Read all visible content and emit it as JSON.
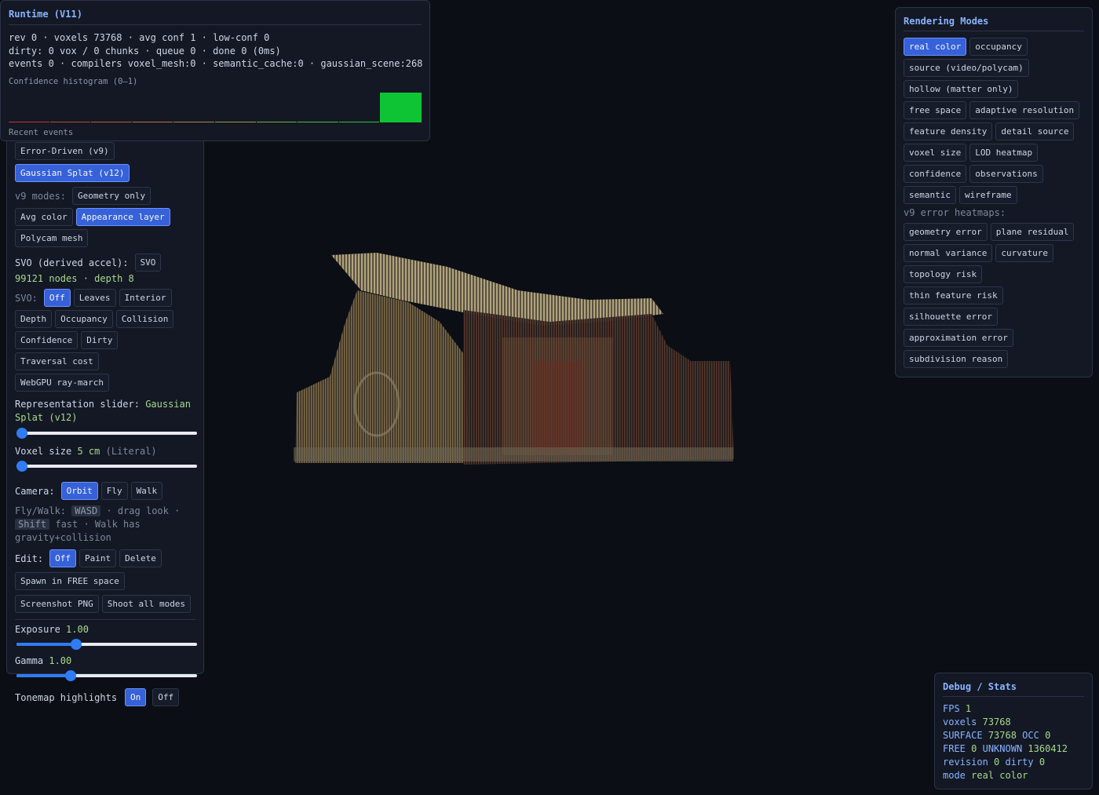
{
  "runtime": {
    "title": "Runtime (V11)",
    "line1": "rev 0 · voxels 73768 · avg conf 1 · low-conf 0",
    "line2": "dirty: 0 vox / 0 chunks · queue 0 · done 0 (0ms)",
    "line3": "events 0 · compilers voxel_mesh:0 · semantic_cache:0 · gaussian_scene:268",
    "histogram_label": "Confidence histogram (0–1)",
    "histogram_bins": [
      0,
      0,
      0,
      0,
      0,
      0,
      0,
      0,
      0,
      1
    ],
    "histogram_colors": [
      "#c4343c",
      "#c44634",
      "#c45a34",
      "#c47034",
      "#b48434",
      "#94a034",
      "#74b034",
      "#54b834",
      "#34c034",
      "#14c83a"
    ],
    "recent_events_label": "Recent events"
  },
  "left": {
    "mode_buttons": [
      {
        "label": "Error-Driven (v9)",
        "active": false
      },
      {
        "label": "Gaussian Splat (v12)",
        "active": true
      }
    ],
    "v9_modes_label": "v9 modes:",
    "v9_modes": [
      {
        "label": "Geometry only",
        "active": false
      },
      {
        "label": "Avg color",
        "active": false
      },
      {
        "label": "Appearance layer",
        "active": true
      },
      {
        "label": "Polycam mesh",
        "active": false
      }
    ],
    "svo_label": "SVO (derived accel):",
    "svo_button": "SVO",
    "svo_nodes": "99121 nodes",
    "svo_depth": "depth 8",
    "svo_modes_label": "SVO:",
    "svo_modes": [
      {
        "label": "Off",
        "active": true
      },
      {
        "label": "Leaves",
        "active": false
      },
      {
        "label": "Interior",
        "active": false
      },
      {
        "label": "Depth",
        "active": false
      },
      {
        "label": "Occupancy",
        "active": false
      },
      {
        "label": "Collision",
        "active": false
      },
      {
        "label": "Confidence",
        "active": false
      },
      {
        "label": "Dirty",
        "active": false
      },
      {
        "label": "Traversal cost",
        "active": false
      },
      {
        "label": "WebGPU ray-march",
        "active": false
      }
    ],
    "rep_slider_label": "Representation slider:",
    "rep_slider_value": "Gaussian Splat (v12)",
    "rep_slider_level": 0,
    "voxel_size_label": "Voxel size",
    "voxel_size_value": "5 cm",
    "voxel_size_note": "(Literal)",
    "voxel_size_level": 0,
    "camera_label": "Camera:",
    "camera_modes": [
      {
        "label": "Orbit",
        "active": true
      },
      {
        "label": "Fly",
        "active": false
      },
      {
        "label": "Walk",
        "active": false
      }
    ],
    "fly_walk_label": "Fly/Walk:",
    "key_wasd": "WASD",
    "drag_look": "· drag look ·",
    "key_shift": "Shift",
    "fast_text": "fast · Walk has gravity+collision",
    "edit_label": "Edit:",
    "edit_modes": [
      {
        "label": "Off",
        "active": true
      },
      {
        "label": "Paint",
        "active": false
      },
      {
        "label": "Delete",
        "active": false
      }
    ],
    "spawn_button": "Spawn in FREE space",
    "screenshot_button": "Screenshot PNG",
    "shoot_all_button": "Shoot all modes",
    "exposure_label": "Exposure",
    "exposure_value": "1.00",
    "exposure_level": 0.33,
    "gamma_label": "Gamma",
    "gamma_value": "1.00",
    "gamma_level": 0.3,
    "tonemap_label": "Tonemap highlights",
    "tonemap_on": "On",
    "tonemap_off": "Off"
  },
  "modes": {
    "title": "Rendering Modes",
    "rows": [
      [
        {
          "label": "real color",
          "active": true
        },
        {
          "label": "occupancy",
          "active": false
        }
      ],
      [
        {
          "label": "source (video/polycam)",
          "active": false
        }
      ],
      [
        {
          "label": "hollow (matter only)",
          "active": false
        }
      ],
      [
        {
          "label": "free space",
          "active": false
        },
        {
          "label": "adaptive resolution",
          "active": false
        }
      ],
      [
        {
          "label": "feature density",
          "active": false
        },
        {
          "label": "detail source",
          "active": false
        }
      ],
      [
        {
          "label": "voxel size",
          "active": false
        },
        {
          "label": "LOD heatmap",
          "active": false
        }
      ],
      [
        {
          "label": "confidence",
          "active": false
        },
        {
          "label": "observations",
          "active": false
        }
      ],
      [
        {
          "label": "semantic",
          "active": false
        },
        {
          "label": "wireframe",
          "active": false
        }
      ]
    ],
    "heatmaps_label": "v9 error heatmaps:",
    "heatmap_rows": [
      [
        {
          "label": "geometry error",
          "active": false
        },
        {
          "label": "plane residual",
          "active": false
        }
      ],
      [
        {
          "label": "normal variance",
          "active": false
        },
        {
          "label": "curvature",
          "active": false
        }
      ],
      [
        {
          "label": "topology risk",
          "active": false
        }
      ],
      [
        {
          "label": "thin feature risk",
          "active": false
        }
      ],
      [
        {
          "label": "silhouette error",
          "active": false
        }
      ],
      [
        {
          "label": "approximation error",
          "active": false
        }
      ],
      [
        {
          "label": "subdivision reason",
          "active": false
        }
      ]
    ]
  },
  "debug": {
    "title": "Debug / Stats",
    "fps_label": "FPS",
    "fps": "1",
    "voxels_label": "voxels",
    "voxels": "73768",
    "surface_label": "SURFACE",
    "surface": "73768",
    "occ_label": "OCC",
    "occ": "0",
    "free_label": "FREE",
    "free": "0",
    "unknown_label": "UNKNOWN",
    "unknown": "1360412",
    "revision_label": "revision",
    "revision": "0",
    "dirty_label": "dirty",
    "dirty": "0",
    "mode_label": "mode",
    "mode": "real color"
  }
}
